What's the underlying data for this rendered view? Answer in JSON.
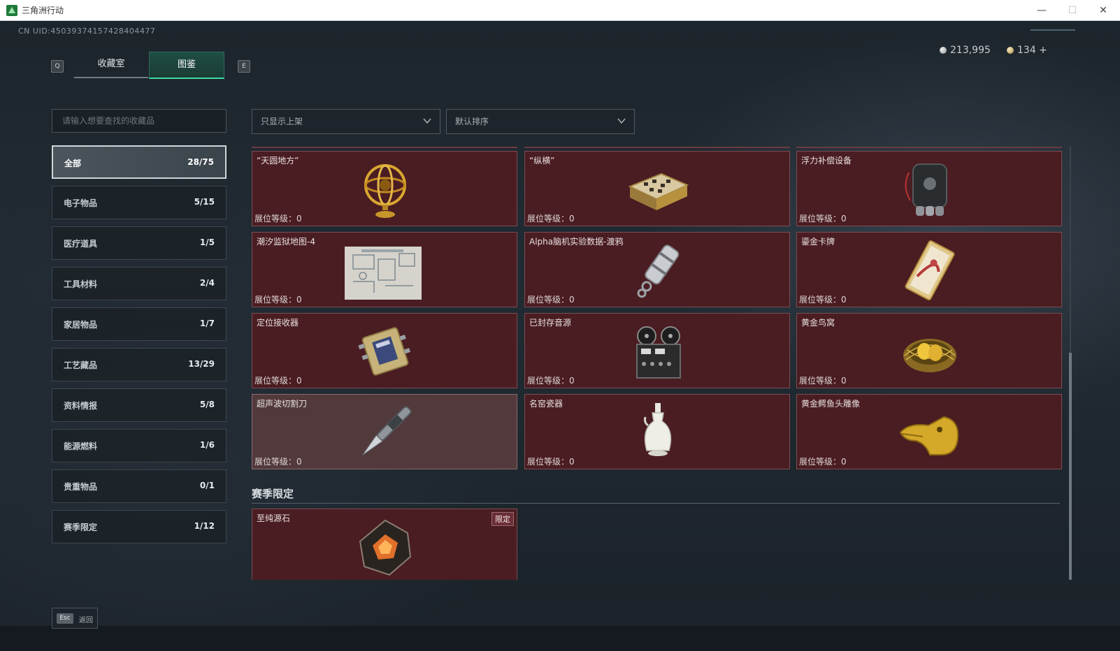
{
  "window": {
    "title": "三角洲行动",
    "minimize": "—",
    "maximize": "☐",
    "close": "✕"
  },
  "header": {
    "uid": "CN UID:4503937415742840447​7",
    "key_left": "Q",
    "key_right": "E",
    "tabs": [
      {
        "label": "收藏室",
        "active": false
      },
      {
        "label": "图鉴",
        "active": true
      }
    ],
    "currency_silver": "213,995",
    "currency_gold": "134 +"
  },
  "search": {
    "placeholder": "请输入想要查找的收藏品"
  },
  "categories": [
    {
      "label": "全部",
      "count": "28/75",
      "active": true
    },
    {
      "label": "电子物品",
      "count": "5/15"
    },
    {
      "label": "医疗道具",
      "count": "1/5"
    },
    {
      "label": "工具材料",
      "count": "2/4"
    },
    {
      "label": "家居物品",
      "count": "1/7"
    },
    {
      "label": "工艺藏品",
      "count": "13/29"
    },
    {
      "label": "资料情报",
      "count": "5/8"
    },
    {
      "label": "能源燃料",
      "count": "1/6"
    },
    {
      "label": "贵重物品",
      "count": "0/1"
    },
    {
      "label": "赛季限定",
      "count": "1/12"
    }
  ],
  "filters": {
    "show_filter": "只显示上架",
    "sort": "默认排序"
  },
  "items": [
    {
      "name": "“天圆地方”",
      "level": "展位等级：0",
      "icon": "armillary-sphere"
    },
    {
      "name": "“纵横”",
      "level": "展位等级：0",
      "icon": "chess-box"
    },
    {
      "name": "浮力补偿设备",
      "level": "展位等级：0",
      "icon": "buoyancy-device"
    },
    {
      "name": "潮汐监狱地图-4",
      "level": "展位等级：0",
      "icon": "map-blueprint"
    },
    {
      "name": "Alpha脑机实验数据-渡鸦",
      "level": "展位等级：0",
      "icon": "data-cylinder"
    },
    {
      "name": "鎏金卡牌",
      "level": "展位等级：0",
      "icon": "gilded-card"
    },
    {
      "name": "定位接收器",
      "level": "展位等级：0",
      "icon": "locator-receiver"
    },
    {
      "name": "已封存音源",
      "level": "展位等级：0",
      "icon": "reel-recorder"
    },
    {
      "name": "黄金鸟窝",
      "level": "展位等级：0",
      "icon": "golden-nest"
    },
    {
      "name": "超声波切割刀",
      "level": "展位等级：0",
      "icon": "ultrasonic-knife",
      "highlight": true
    },
    {
      "name": "名窑瓷器",
      "level": "展位等级：0",
      "icon": "porcelain-vase"
    },
    {
      "name": "黄金鳄鱼头雕像",
      "level": "展位等级：0",
      "icon": "golden-crocodile"
    }
  ],
  "season_section": {
    "title": "赛季限定",
    "items": [
      {
        "name": "至纯源石",
        "tag": "限定",
        "icon": "pure-source-stone"
      }
    ]
  },
  "footer": {
    "esc_key": "Esc",
    "back_label": "返回"
  }
}
